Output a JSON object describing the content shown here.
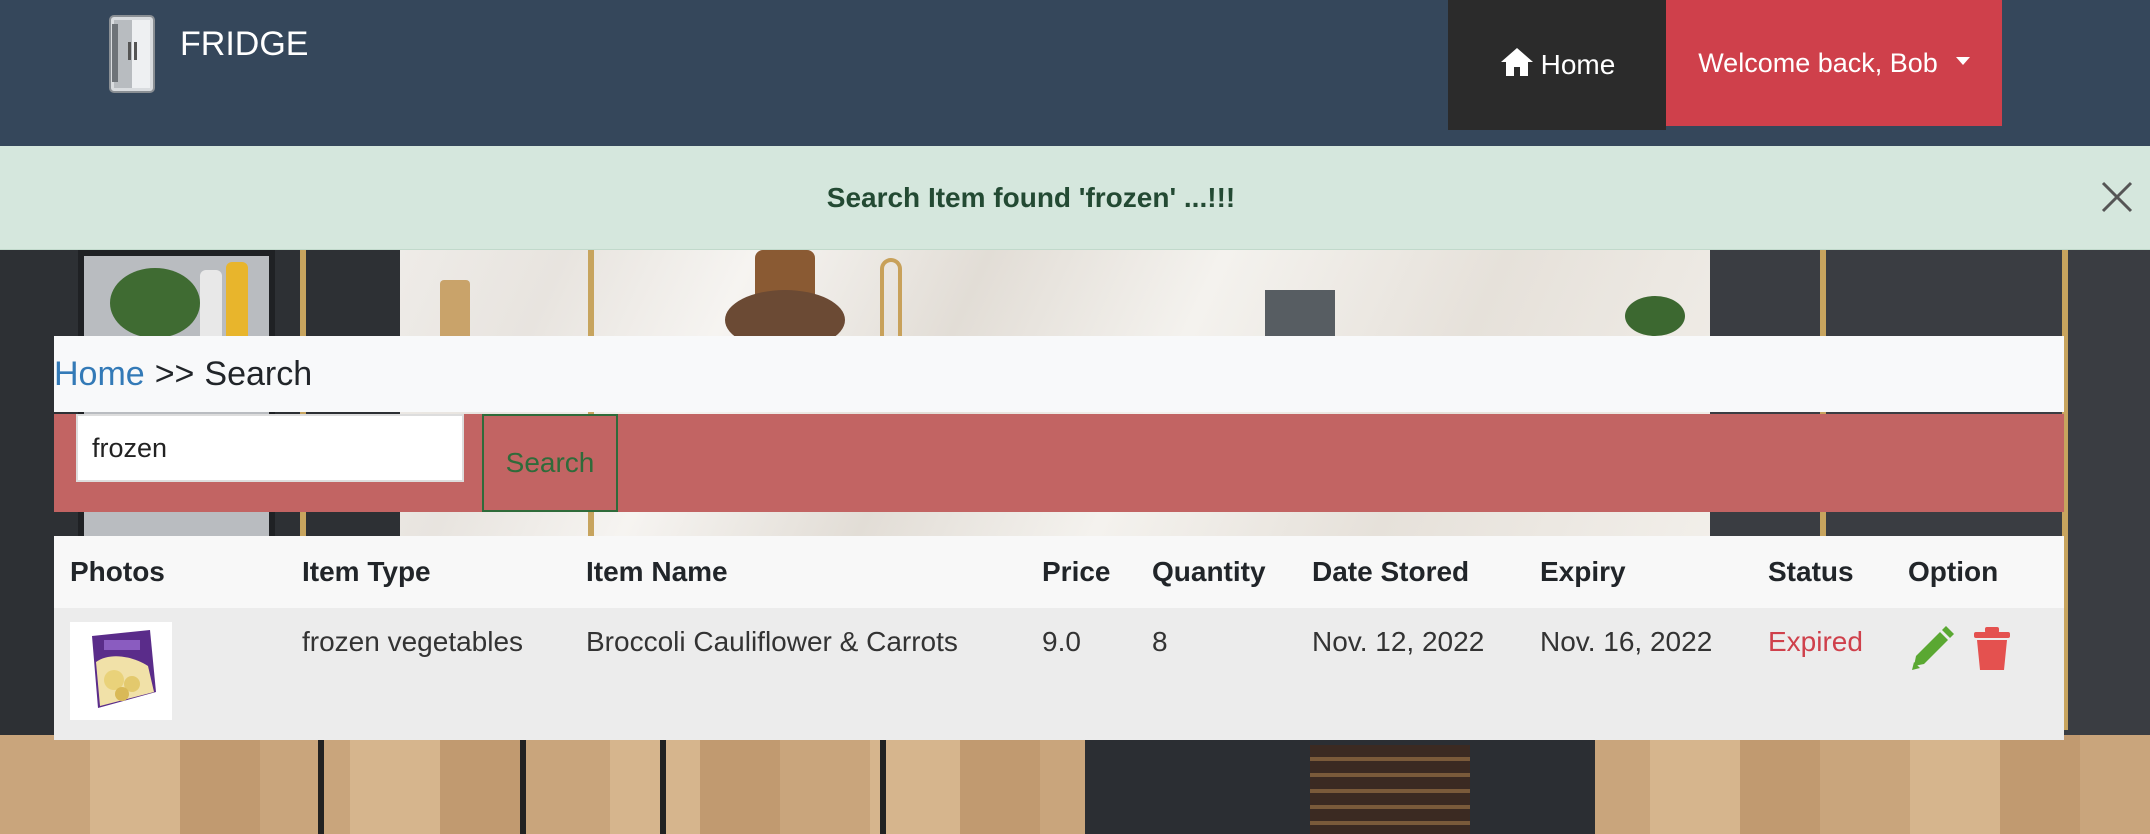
{
  "navbar": {
    "brand": "FRIDGE",
    "home_label": "Home",
    "user_label": "Welcome back, Bob"
  },
  "alert": {
    "message": "Search Item found 'frozen' ...!!!"
  },
  "breadcrumb": {
    "home": "Home",
    "separator": ">>",
    "current": "Search"
  },
  "search": {
    "value": "frozen",
    "button_label": "Search"
  },
  "table": {
    "headers": {
      "photos": "Photos",
      "item_type": "Item Type",
      "item_name": "Item Name",
      "price": "Price",
      "quantity": "Quantity",
      "date_stored": "Date Stored",
      "expiry": "Expiry",
      "status": "Status",
      "option": "Option"
    },
    "rows": [
      {
        "item_type": "frozen vegetables",
        "item_name": "Broccoli Cauliflower & Carrots",
        "price": "9.0",
        "quantity": "8",
        "date_stored": "Nov. 12, 2022",
        "expiry": "Nov. 16, 2022",
        "status": "Expired"
      }
    ]
  },
  "colors": {
    "navbar": "#35475b",
    "accent_red": "#cf404b",
    "alert_bg": "#d5e7dd",
    "search_bar": "#c26463",
    "edit_green": "#5aa832"
  },
  "icons": {
    "brand": "fridge-icon",
    "home": "home-icon",
    "dropdown": "caret-down-icon",
    "close": "close-icon",
    "edit": "pencil-icon",
    "delete": "trash-icon"
  }
}
